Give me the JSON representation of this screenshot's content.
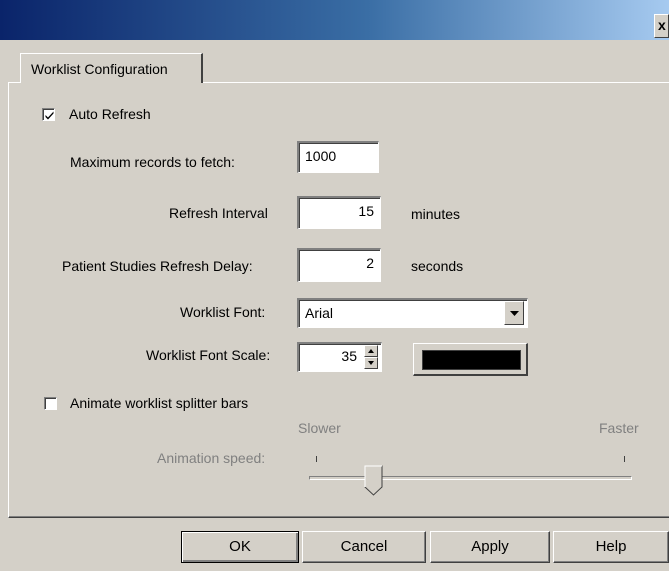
{
  "window": {
    "close_glyph": "x"
  },
  "tabs": [
    {
      "label": "Worklist Configuration"
    }
  ],
  "auto_refresh": {
    "label": "Auto Refresh",
    "checked": true
  },
  "max_records": {
    "label": "Maximum records to fetch:",
    "value": "1000"
  },
  "refresh_interval": {
    "label": "Refresh Interval",
    "value": "15",
    "unit": "minutes"
  },
  "patient_delay": {
    "label": "Patient Studies Refresh Delay:",
    "value": "2",
    "unit": "seconds"
  },
  "worklist_font": {
    "label": "Worklist Font:",
    "value": "Arial"
  },
  "font_scale": {
    "label": "Worklist Font Scale:",
    "value": "35"
  },
  "font_color": {
    "swatch": "#000000"
  },
  "animate_splitter": {
    "label": "Animate worklist splitter bars",
    "checked": false
  },
  "animation": {
    "label": "Animation speed:",
    "min_label": "Slower",
    "max_label": "Faster",
    "level": 0.2
  },
  "buttons": {
    "ok": "OK",
    "cancel": "Cancel",
    "apply": "Apply",
    "help": "Help"
  },
  "colors": {
    "face": "#d4d0c8",
    "titlebar_start": "#0a246a",
    "titlebar_end": "#a6caf0"
  }
}
